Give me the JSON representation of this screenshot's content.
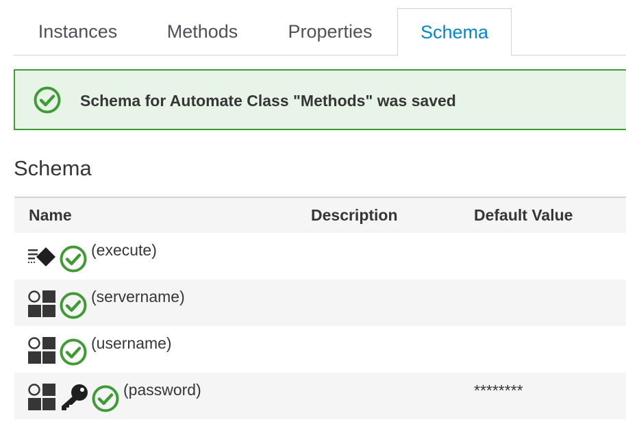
{
  "tabs": [
    {
      "label": "Instances",
      "active": false
    },
    {
      "label": "Methods",
      "active": false
    },
    {
      "label": "Properties",
      "active": false
    },
    {
      "label": "Schema",
      "active": true
    }
  ],
  "alert": {
    "type": "success",
    "message": "Schema for Automate Class \"Methods\" was saved"
  },
  "section_title": "Schema",
  "table": {
    "columns": [
      "Name",
      "Description",
      "Default Value"
    ],
    "rows": [
      {
        "icons": [
          "method-icon",
          "success-check-icon"
        ],
        "name": "(execute)",
        "description": "",
        "default_value": ""
      },
      {
        "icons": [
          "attribute-icon",
          "success-check-icon"
        ],
        "name": "(servername)",
        "description": "",
        "default_value": ""
      },
      {
        "icons": [
          "attribute-icon",
          "success-check-icon"
        ],
        "name": "(username)",
        "description": "",
        "default_value": ""
      },
      {
        "icons": [
          "attribute-icon",
          "key-icon",
          "success-check-icon"
        ],
        "name": "(password)",
        "description": "",
        "default_value": "********"
      }
    ]
  },
  "colors": {
    "accent": "#0088ce",
    "success": "#3f9c35",
    "success_bg": "#e9f4e9",
    "row_alt": "#f5f5f5"
  }
}
